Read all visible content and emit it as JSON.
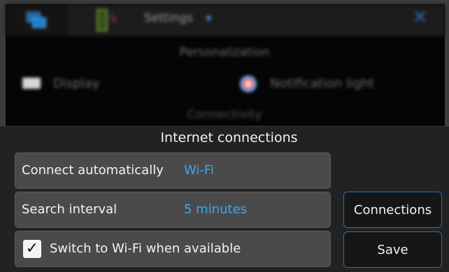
{
  "background": {
    "topbar": {
      "title": "Settings"
    },
    "section_personalization": "Personalization",
    "items": [
      {
        "label": "Display",
        "icon": "display-icon"
      },
      {
        "label": "Notification light",
        "icon": "notification-light-icon"
      }
    ],
    "section_connectivity": "Connectivity"
  },
  "dialog": {
    "title": "Internet connections",
    "rows": [
      {
        "label": "Connect automatically",
        "value": "Wi-Fi"
      },
      {
        "label": "Search interval",
        "value": "5 minutes"
      }
    ],
    "checkbox": {
      "label": "Switch to Wi-Fi when available",
      "checked": true
    },
    "buttons": {
      "connections": "Connections",
      "save": "Save"
    }
  },
  "colors": {
    "accent": "#3aa8ef",
    "button_border": "#2c70b8",
    "sheet_bg": "#222222",
    "row_bg": "#4a4a4a"
  }
}
